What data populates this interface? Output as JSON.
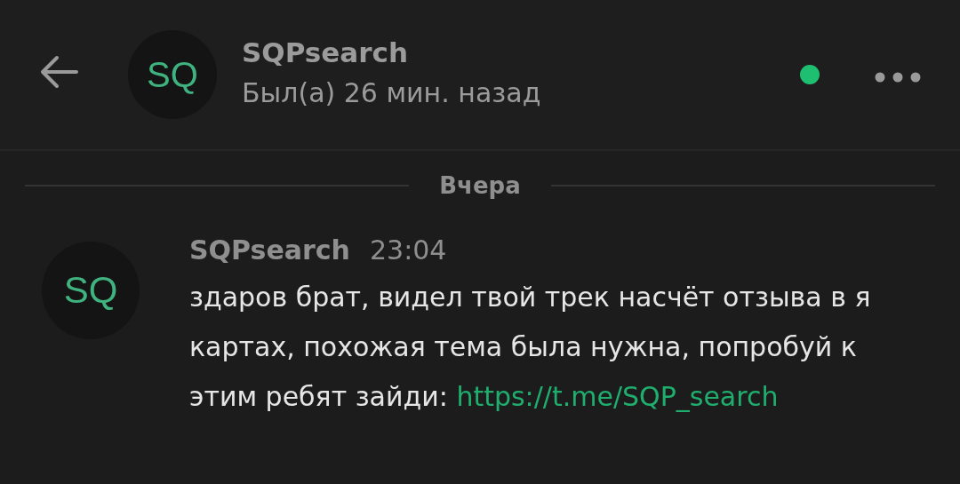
{
  "header": {
    "avatar": "SQ",
    "title": "SQPsearch",
    "status": "Был(а) 26 мин. назад",
    "online": true
  },
  "date_separator": "Вчера",
  "messages": [
    {
      "avatar": "SQ",
      "author": "SQPsearch",
      "time": "23:04",
      "text": "здаров брат, видел твой трек насчёт отзыва в я картах, похожая тема была нужна, попробуй к этим ребят зайди: ",
      "link": "https://t.me/SQP_search"
    }
  ]
}
